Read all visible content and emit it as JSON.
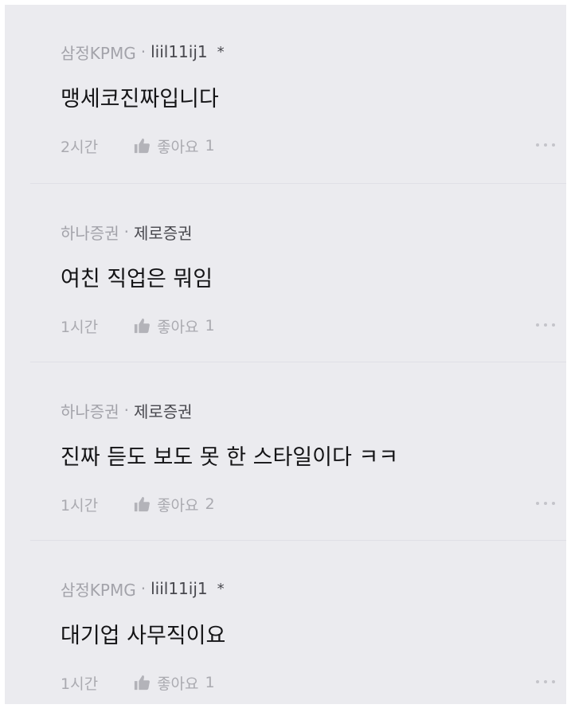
{
  "comments": [
    {
      "company": "삼정KPMG",
      "nickname": "liil11ij1",
      "author_marker": "*",
      "text": "맹세코진짜입니다",
      "time": "2시간",
      "like_label": "좋아요",
      "like_count": "1"
    },
    {
      "company": "하나증권",
      "nickname": "제로증권",
      "author_marker": "",
      "text": "여친 직업은 뭐임",
      "time": "1시간",
      "like_label": "좋아요",
      "like_count": "1"
    },
    {
      "company": "하나증권",
      "nickname": "제로증권",
      "author_marker": "",
      "text": "진짜 듣도 보도 못 한 스타일이다 ㅋㅋ",
      "time": "1시간",
      "like_label": "좋아요",
      "like_count": "2"
    },
    {
      "company": "삼정KPMG",
      "nickname": "liil11ij1",
      "author_marker": "*",
      "text": "대기업 사무직이요",
      "time": "1시간",
      "like_label": "좋아요",
      "like_count": "1"
    }
  ],
  "separator": "·",
  "icons": {
    "like": "thumbs-up-icon",
    "more": "more-dots-icon"
  },
  "colors": {
    "background": "#ebebef",
    "text_primary": "#141416",
    "text_muted": "#a3a3aa"
  }
}
